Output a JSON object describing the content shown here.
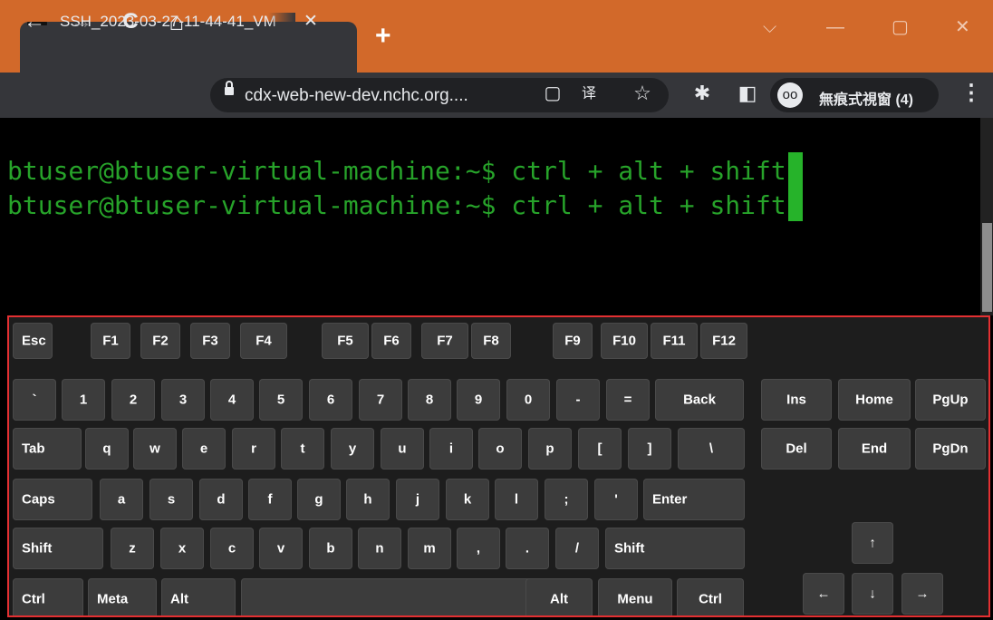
{
  "browser": {
    "tab_title": "SSH_2023-03-27-11-44-41_VM",
    "tab_close": "✕",
    "new_tab": "+",
    "window_controls": {
      "minimize": "—",
      "restore": "▢",
      "close": "✕",
      "chevron": "⌵"
    },
    "nav": {
      "back": "←",
      "forward": "→",
      "reload": "C",
      "home": "⌂"
    },
    "url": "cdx-web-new-dev.nchc.org....",
    "omnibox_icons": {
      "copy": "▢",
      "translate": "译",
      "bookmark": "☆"
    },
    "extensions": "✱",
    "sidepanel": "◧",
    "incognito_label": "無痕式視窗 (4)",
    "incognito_icon": "oo",
    "menu": "⋮"
  },
  "terminal": {
    "lines": [
      "btuser@btuser-virtual-machine:~$ ctrl + alt + shift",
      "btuser@btuser-virtual-machine:~$ ctrl + alt + shift"
    ]
  },
  "keyboard": {
    "keys": [
      {
        "label": "Esc"
      },
      {
        "label": "F1"
      },
      {
        "label": "F2"
      },
      {
        "label": "F3"
      },
      {
        "label": "F4"
      },
      {
        "label": "F5"
      },
      {
        "label": "F6"
      },
      {
        "label": "F7"
      },
      {
        "label": "F8"
      },
      {
        "label": "F9"
      },
      {
        "label": "F10"
      },
      {
        "label": "F11"
      },
      {
        "label": "F12"
      },
      {
        "label": "`"
      },
      {
        "label": "1"
      },
      {
        "label": "2"
      },
      {
        "label": "3"
      },
      {
        "label": "4"
      },
      {
        "label": "5"
      },
      {
        "label": "6"
      },
      {
        "label": "7"
      },
      {
        "label": "8"
      },
      {
        "label": "9"
      },
      {
        "label": "0"
      },
      {
        "label": "-"
      },
      {
        "label": "="
      },
      {
        "label": "Back"
      },
      {
        "label": "Ins"
      },
      {
        "label": "Home"
      },
      {
        "label": "PgUp"
      },
      {
        "label": "Tab"
      },
      {
        "label": "q"
      },
      {
        "label": "w"
      },
      {
        "label": "e"
      },
      {
        "label": "r"
      },
      {
        "label": "t"
      },
      {
        "label": "y"
      },
      {
        "label": "u"
      },
      {
        "label": "i"
      },
      {
        "label": "o"
      },
      {
        "label": "p"
      },
      {
        "label": "["
      },
      {
        "label": "]"
      },
      {
        "label": "\\"
      },
      {
        "label": "Del"
      },
      {
        "label": "End"
      },
      {
        "label": "PgDn"
      },
      {
        "label": "Caps"
      },
      {
        "label": "a"
      },
      {
        "label": "s"
      },
      {
        "label": "d"
      },
      {
        "label": "f"
      },
      {
        "label": "g"
      },
      {
        "label": "h"
      },
      {
        "label": "j"
      },
      {
        "label": "k"
      },
      {
        "label": "l"
      },
      {
        "label": ";"
      },
      {
        "label": "'"
      },
      {
        "label": "Enter"
      },
      {
        "label": "Shift"
      },
      {
        "label": "z"
      },
      {
        "label": "x"
      },
      {
        "label": "c"
      },
      {
        "label": "v"
      },
      {
        "label": "b"
      },
      {
        "label": "n"
      },
      {
        "label": "m"
      },
      {
        "label": ","
      },
      {
        "label": "."
      },
      {
        "label": "/"
      },
      {
        "label": "Shift"
      },
      {
        "label": "↑"
      },
      {
        "label": "Ctrl"
      },
      {
        "label": "Meta"
      },
      {
        "label": "Alt"
      },
      {
        "label": ""
      },
      {
        "label": "Alt"
      },
      {
        "label": "Menu"
      },
      {
        "label": "Ctrl"
      },
      {
        "label": "←"
      },
      {
        "label": "↓"
      },
      {
        "label": "→"
      }
    ]
  }
}
